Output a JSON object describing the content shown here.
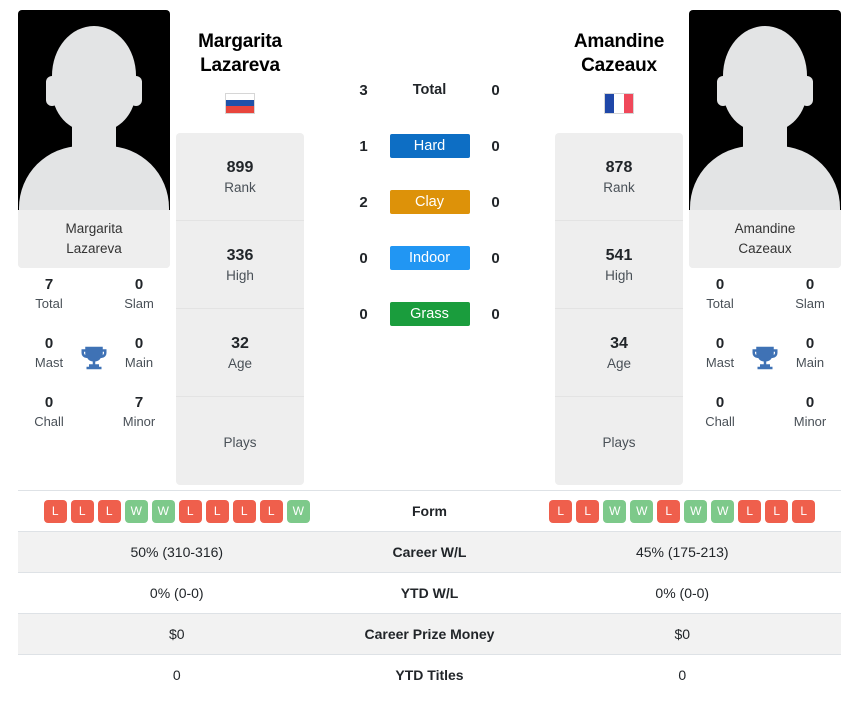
{
  "colors": {
    "win": "#7dc98a",
    "loss": "#ef5f4c",
    "hard": "#0d6ec4",
    "clay": "#dd9209",
    "indoor": "#2196f3",
    "grass": "#1a9d3d",
    "trophy": "#3f72b5",
    "card_bg": "#eeeeee",
    "stripe": "#f2f2f2"
  },
  "players": {
    "left": {
      "name": "Margarita Lazareva",
      "name_line1": "Margarita",
      "name_line2": "Lazareva",
      "caption_line1": "Margarita",
      "caption_line2": "Lazareva",
      "flag": "russia-flag",
      "flag_type": "horiz",
      "flag_stripes": [
        "#ffffff",
        "#2051a8",
        "#e8453c"
      ],
      "info": [
        {
          "value": "899",
          "label": "Rank"
        },
        {
          "value": "336",
          "label": "High"
        },
        {
          "value": "32",
          "label": "Age"
        },
        {
          "value": "",
          "label": "Plays"
        }
      ],
      "titles": [
        {
          "value": "7",
          "label": "Total"
        },
        {
          "value": "0",
          "label": "Slam"
        },
        {
          "value": "0",
          "label": "Mast"
        },
        {
          "value": "0",
          "label": "Main"
        },
        {
          "value": "0",
          "label": "Chall"
        },
        {
          "value": "7",
          "label": "Minor"
        }
      ],
      "form": [
        "L",
        "L",
        "L",
        "W",
        "W",
        "L",
        "L",
        "L",
        "L",
        "W"
      ],
      "career_wl": "50% (310-316)",
      "ytd_wl": "0% (0-0)",
      "prize_money": "$0",
      "ytd_titles": "0"
    },
    "right": {
      "name": "Amandine Cazeaux",
      "name_line1": "Amandine",
      "name_line2": "Cazeaux",
      "caption_line1": "Amandine",
      "caption_line2": "Cazeaux",
      "flag": "france-flag",
      "flag_type": "vert",
      "flag_stripes": [
        "#1f47a8",
        "#ffffff",
        "#f0485a"
      ],
      "info": [
        {
          "value": "878",
          "label": "Rank"
        },
        {
          "value": "541",
          "label": "High"
        },
        {
          "value": "34",
          "label": "Age"
        },
        {
          "value": "",
          "label": "Plays"
        }
      ],
      "titles": [
        {
          "value": "0",
          "label": "Total"
        },
        {
          "value": "0",
          "label": "Slam"
        },
        {
          "value": "0",
          "label": "Mast"
        },
        {
          "value": "0",
          "label": "Main"
        },
        {
          "value": "0",
          "label": "Chall"
        },
        {
          "value": "0",
          "label": "Minor"
        }
      ],
      "form": [
        "L",
        "L",
        "W",
        "W",
        "L",
        "W",
        "W",
        "L",
        "L",
        "L"
      ],
      "career_wl": "45% (175-213)",
      "ytd_wl": "0% (0-0)",
      "prize_money": "$0",
      "ytd_titles": "0"
    }
  },
  "head_to_head": [
    {
      "label": "Total",
      "left": "3",
      "right": "0",
      "color": "none",
      "style": "plain"
    },
    {
      "label": "Hard",
      "left": "1",
      "right": "0",
      "color": "#0d6ec4",
      "style": "badge"
    },
    {
      "label": "Clay",
      "left": "2",
      "right": "0",
      "color": "#dd9209",
      "style": "badge"
    },
    {
      "label": "Indoor",
      "left": "0",
      "right": "0",
      "color": "#2196f3",
      "style": "badge"
    },
    {
      "label": "Grass",
      "left": "0",
      "right": "0",
      "color": "#1a9d3d",
      "style": "badge"
    }
  ],
  "table_rows": [
    {
      "label": "Form",
      "type": "form",
      "striped": false
    },
    {
      "label": "Career W/L",
      "type": "text",
      "striped": true,
      "left": "50% (310-316)",
      "right": "45% (175-213)"
    },
    {
      "label": "YTD W/L",
      "type": "text",
      "striped": false,
      "left": "0% (0-0)",
      "right": "0% (0-0)"
    },
    {
      "label": "Career Prize Money",
      "type": "text",
      "striped": true,
      "left": "$0",
      "right": "$0"
    },
    {
      "label": "YTD Titles",
      "type": "text",
      "striped": false,
      "left": "0",
      "right": "0"
    }
  ]
}
